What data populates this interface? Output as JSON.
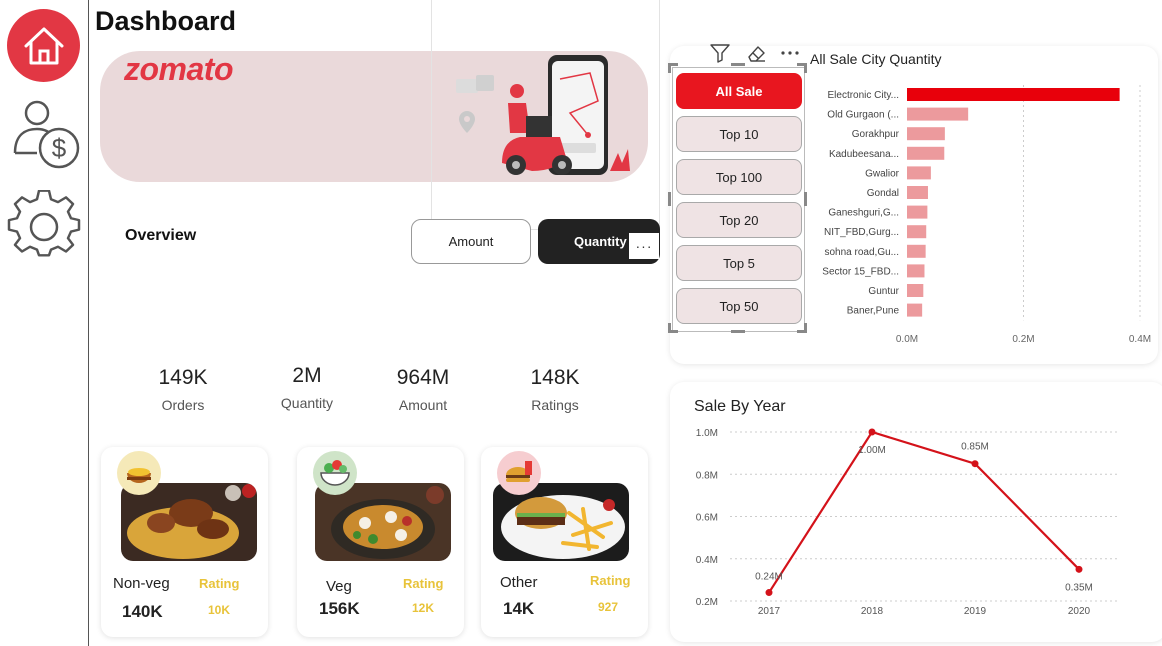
{
  "page": {
    "title": "Dashboard",
    "brand": "zomato",
    "overview_label": "Overview",
    "toggle": {
      "amount_label": "Amount",
      "quantity_label": "Quantity",
      "more_label": "···"
    }
  },
  "nav": [
    "home-icon",
    "user-dollar-icon",
    "gear-icon"
  ],
  "kpis": [
    {
      "value": "149K",
      "label": "Orders"
    },
    {
      "value": "2M",
      "label": "Quantity"
    },
    {
      "value": "964M",
      "label": "Amount"
    },
    {
      "value": "148K",
      "label": "Ratings"
    }
  ],
  "cards": [
    {
      "name": "Non-veg",
      "value": "140K",
      "rating_label": "Rating",
      "rating_value": "10K",
      "icon": "biryani-icon"
    },
    {
      "name": "Veg",
      "value": "156K",
      "rating_label": "Rating",
      "rating_value": "12K",
      "icon": "salad-icon"
    },
    {
      "name": "Other",
      "value": "14K",
      "rating_label": "Rating",
      "rating_value": "927",
      "icon": "fast-food-icon"
    }
  ],
  "slicer": {
    "options": [
      "All Sale",
      "Top 10",
      "Top 100",
      "Top 20",
      "Top 5",
      "Top 50"
    ],
    "selected": "All Sale"
  },
  "colors": {
    "accent": "#e23744",
    "bar_primary": "#e8000b",
    "bar_secondary": "#ec9a9d",
    "line": "#d4121a",
    "rating": "#e8c33a"
  },
  "chart_data": [
    {
      "type": "bar",
      "orientation": "horizontal",
      "title": "All Sale City Quantity",
      "categories": [
        "Electronic City...",
        "Old Gurgaon (...",
        "Gorakhpur",
        "Kadubeesana...",
        "Gwalior",
        "Gondal",
        "Ganeshguri,G...",
        "NIT_FBD,Gurg...",
        "sohna road,Gu...",
        "Sector 15_FBD...",
        "Guntur",
        "Baner,Pune"
      ],
      "values": [
        0.365,
        0.105,
        0.065,
        0.064,
        0.041,
        0.036,
        0.035,
        0.033,
        0.032,
        0.03,
        0.028,
        0.026
      ],
      "xticks": [
        "0.0M",
        "0.2M",
        "0.4M"
      ],
      "xlim": [
        0,
        0.4
      ],
      "unit": "M",
      "grid": true
    },
    {
      "type": "line",
      "title": "Sale By Year",
      "x": [
        "2017",
        "2018",
        "2019",
        "2020"
      ],
      "values": [
        0.24,
        1.0,
        0.85,
        0.35
      ],
      "data_labels": [
        "0.24M",
        "1.00M",
        "0.85M",
        "0.35M"
      ],
      "yticks": [
        "0.2M",
        "0.4M",
        "0.6M",
        "0.8M",
        "1.0M"
      ],
      "ylim": [
        0.2,
        1.0
      ],
      "grid": true
    }
  ]
}
